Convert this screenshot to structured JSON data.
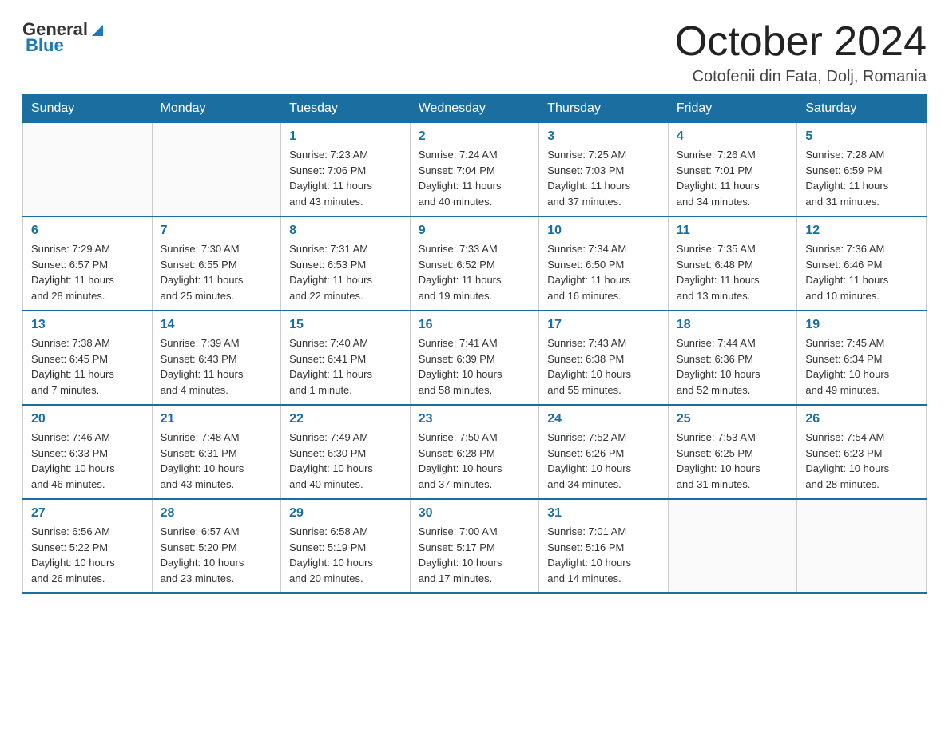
{
  "logo": {
    "general": "General",
    "blue": "Blue"
  },
  "title": "October 2024",
  "location": "Cotofenii din Fata, Dolj, Romania",
  "weekdays": [
    "Sunday",
    "Monday",
    "Tuesday",
    "Wednesday",
    "Thursday",
    "Friday",
    "Saturday"
  ],
  "weeks": [
    [
      {
        "day": "",
        "info": ""
      },
      {
        "day": "",
        "info": ""
      },
      {
        "day": "1",
        "info": "Sunrise: 7:23 AM\nSunset: 7:06 PM\nDaylight: 11 hours\nand 43 minutes."
      },
      {
        "day": "2",
        "info": "Sunrise: 7:24 AM\nSunset: 7:04 PM\nDaylight: 11 hours\nand 40 minutes."
      },
      {
        "day": "3",
        "info": "Sunrise: 7:25 AM\nSunset: 7:03 PM\nDaylight: 11 hours\nand 37 minutes."
      },
      {
        "day": "4",
        "info": "Sunrise: 7:26 AM\nSunset: 7:01 PM\nDaylight: 11 hours\nand 34 minutes."
      },
      {
        "day": "5",
        "info": "Sunrise: 7:28 AM\nSunset: 6:59 PM\nDaylight: 11 hours\nand 31 minutes."
      }
    ],
    [
      {
        "day": "6",
        "info": "Sunrise: 7:29 AM\nSunset: 6:57 PM\nDaylight: 11 hours\nand 28 minutes."
      },
      {
        "day": "7",
        "info": "Sunrise: 7:30 AM\nSunset: 6:55 PM\nDaylight: 11 hours\nand 25 minutes."
      },
      {
        "day": "8",
        "info": "Sunrise: 7:31 AM\nSunset: 6:53 PM\nDaylight: 11 hours\nand 22 minutes."
      },
      {
        "day": "9",
        "info": "Sunrise: 7:33 AM\nSunset: 6:52 PM\nDaylight: 11 hours\nand 19 minutes."
      },
      {
        "day": "10",
        "info": "Sunrise: 7:34 AM\nSunset: 6:50 PM\nDaylight: 11 hours\nand 16 minutes."
      },
      {
        "day": "11",
        "info": "Sunrise: 7:35 AM\nSunset: 6:48 PM\nDaylight: 11 hours\nand 13 minutes."
      },
      {
        "day": "12",
        "info": "Sunrise: 7:36 AM\nSunset: 6:46 PM\nDaylight: 11 hours\nand 10 minutes."
      }
    ],
    [
      {
        "day": "13",
        "info": "Sunrise: 7:38 AM\nSunset: 6:45 PM\nDaylight: 11 hours\nand 7 minutes."
      },
      {
        "day": "14",
        "info": "Sunrise: 7:39 AM\nSunset: 6:43 PM\nDaylight: 11 hours\nand 4 minutes."
      },
      {
        "day": "15",
        "info": "Sunrise: 7:40 AM\nSunset: 6:41 PM\nDaylight: 11 hours\nand 1 minute."
      },
      {
        "day": "16",
        "info": "Sunrise: 7:41 AM\nSunset: 6:39 PM\nDaylight: 10 hours\nand 58 minutes."
      },
      {
        "day": "17",
        "info": "Sunrise: 7:43 AM\nSunset: 6:38 PM\nDaylight: 10 hours\nand 55 minutes."
      },
      {
        "day": "18",
        "info": "Sunrise: 7:44 AM\nSunset: 6:36 PM\nDaylight: 10 hours\nand 52 minutes."
      },
      {
        "day": "19",
        "info": "Sunrise: 7:45 AM\nSunset: 6:34 PM\nDaylight: 10 hours\nand 49 minutes."
      }
    ],
    [
      {
        "day": "20",
        "info": "Sunrise: 7:46 AM\nSunset: 6:33 PM\nDaylight: 10 hours\nand 46 minutes."
      },
      {
        "day": "21",
        "info": "Sunrise: 7:48 AM\nSunset: 6:31 PM\nDaylight: 10 hours\nand 43 minutes."
      },
      {
        "day": "22",
        "info": "Sunrise: 7:49 AM\nSunset: 6:30 PM\nDaylight: 10 hours\nand 40 minutes."
      },
      {
        "day": "23",
        "info": "Sunrise: 7:50 AM\nSunset: 6:28 PM\nDaylight: 10 hours\nand 37 minutes."
      },
      {
        "day": "24",
        "info": "Sunrise: 7:52 AM\nSunset: 6:26 PM\nDaylight: 10 hours\nand 34 minutes."
      },
      {
        "day": "25",
        "info": "Sunrise: 7:53 AM\nSunset: 6:25 PM\nDaylight: 10 hours\nand 31 minutes."
      },
      {
        "day": "26",
        "info": "Sunrise: 7:54 AM\nSunset: 6:23 PM\nDaylight: 10 hours\nand 28 minutes."
      }
    ],
    [
      {
        "day": "27",
        "info": "Sunrise: 6:56 AM\nSunset: 5:22 PM\nDaylight: 10 hours\nand 26 minutes."
      },
      {
        "day": "28",
        "info": "Sunrise: 6:57 AM\nSunset: 5:20 PM\nDaylight: 10 hours\nand 23 minutes."
      },
      {
        "day": "29",
        "info": "Sunrise: 6:58 AM\nSunset: 5:19 PM\nDaylight: 10 hours\nand 20 minutes."
      },
      {
        "day": "30",
        "info": "Sunrise: 7:00 AM\nSunset: 5:17 PM\nDaylight: 10 hours\nand 17 minutes."
      },
      {
        "day": "31",
        "info": "Sunrise: 7:01 AM\nSunset: 5:16 PM\nDaylight: 10 hours\nand 14 minutes."
      },
      {
        "day": "",
        "info": ""
      },
      {
        "day": "",
        "info": ""
      }
    ]
  ]
}
